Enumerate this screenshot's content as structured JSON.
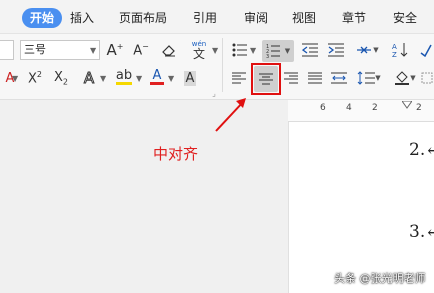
{
  "menu": {
    "tabs": [
      "开始",
      "插入",
      "页面布局",
      "引用",
      "审阅",
      "视图",
      "章节",
      "安全"
    ]
  },
  "ribbon": {
    "font_size_value": "三号",
    "text_style_label": "wén",
    "text_style_glyph": "文",
    "char_a": "A"
  },
  "ruler": {
    "marks": [
      "6",
      "4",
      "2",
      "2"
    ]
  },
  "document": {
    "lines": [
      "2.↵",
      "3.↵"
    ]
  },
  "annotation": {
    "callout_text": "中对齐"
  },
  "watermark": "头条 @张光明老师",
  "colors": {
    "accent_tab": "#4a8ff0",
    "highlight_border": "#e01010",
    "callout": "#e02020",
    "font_color_bar": "#e02020",
    "highlight_bar": "#f5d800"
  }
}
